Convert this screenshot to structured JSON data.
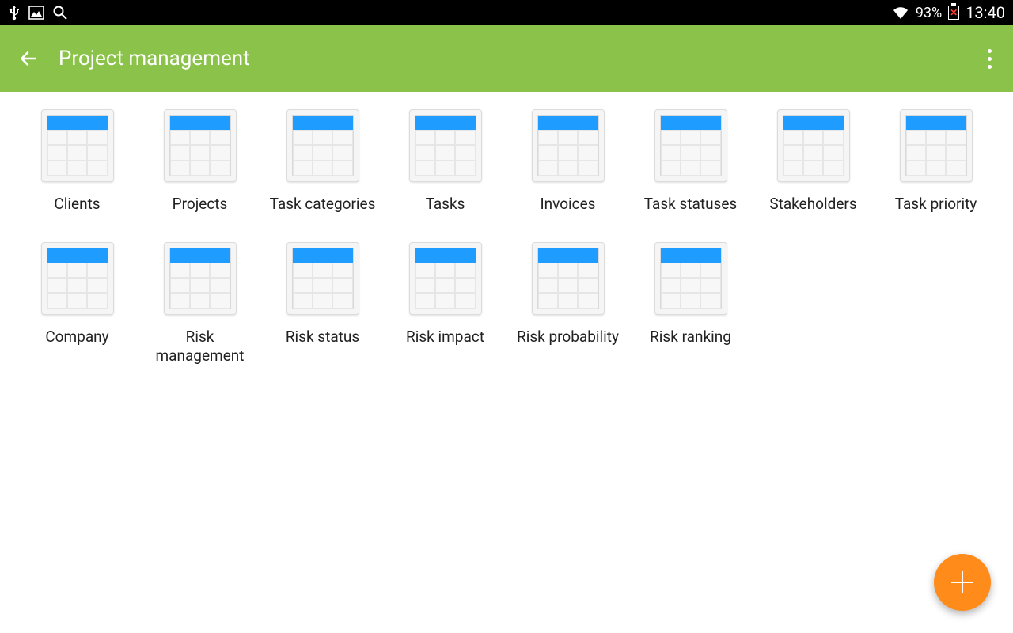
{
  "status_bar": {
    "battery_percent": "93%",
    "clock": "13:40"
  },
  "app_bar": {
    "title": "Project management"
  },
  "tiles": [
    {
      "label": "Clients"
    },
    {
      "label": "Projects"
    },
    {
      "label": "Task categories"
    },
    {
      "label": "Tasks"
    },
    {
      "label": "Invoices"
    },
    {
      "label": "Task statuses"
    },
    {
      "label": "Stakeholders"
    },
    {
      "label": "Task priority"
    },
    {
      "label": "Company"
    },
    {
      "label": "Risk management"
    },
    {
      "label": "Risk status"
    },
    {
      "label": "Risk impact"
    },
    {
      "label": "Risk probability"
    },
    {
      "label": "Risk ranking"
    }
  ]
}
